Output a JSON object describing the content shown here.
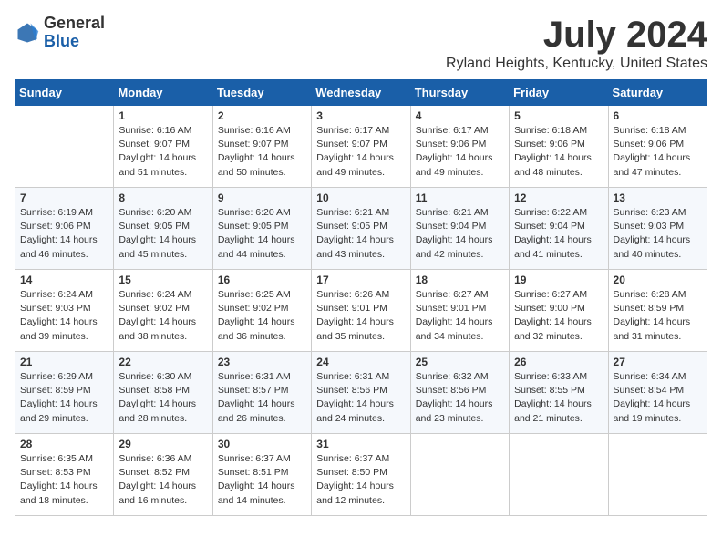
{
  "header": {
    "logo_line1": "General",
    "logo_line2": "Blue",
    "month_year": "July 2024",
    "location": "Ryland Heights, Kentucky, United States"
  },
  "weekdays": [
    "Sunday",
    "Monday",
    "Tuesday",
    "Wednesday",
    "Thursday",
    "Friday",
    "Saturday"
  ],
  "weeks": [
    [
      {
        "day": "",
        "sunrise": "",
        "sunset": "",
        "daylight": ""
      },
      {
        "day": "1",
        "sunrise": "Sunrise: 6:16 AM",
        "sunset": "Sunset: 9:07 PM",
        "daylight": "Daylight: 14 hours and 51 minutes."
      },
      {
        "day": "2",
        "sunrise": "Sunrise: 6:16 AM",
        "sunset": "Sunset: 9:07 PM",
        "daylight": "Daylight: 14 hours and 50 minutes."
      },
      {
        "day": "3",
        "sunrise": "Sunrise: 6:17 AM",
        "sunset": "Sunset: 9:07 PM",
        "daylight": "Daylight: 14 hours and 49 minutes."
      },
      {
        "day": "4",
        "sunrise": "Sunrise: 6:17 AM",
        "sunset": "Sunset: 9:06 PM",
        "daylight": "Daylight: 14 hours and 49 minutes."
      },
      {
        "day": "5",
        "sunrise": "Sunrise: 6:18 AM",
        "sunset": "Sunset: 9:06 PM",
        "daylight": "Daylight: 14 hours and 48 minutes."
      },
      {
        "day": "6",
        "sunrise": "Sunrise: 6:18 AM",
        "sunset": "Sunset: 9:06 PM",
        "daylight": "Daylight: 14 hours and 47 minutes."
      }
    ],
    [
      {
        "day": "7",
        "sunrise": "Sunrise: 6:19 AM",
        "sunset": "Sunset: 9:06 PM",
        "daylight": "Daylight: 14 hours and 46 minutes."
      },
      {
        "day": "8",
        "sunrise": "Sunrise: 6:20 AM",
        "sunset": "Sunset: 9:05 PM",
        "daylight": "Daylight: 14 hours and 45 minutes."
      },
      {
        "day": "9",
        "sunrise": "Sunrise: 6:20 AM",
        "sunset": "Sunset: 9:05 PM",
        "daylight": "Daylight: 14 hours and 44 minutes."
      },
      {
        "day": "10",
        "sunrise": "Sunrise: 6:21 AM",
        "sunset": "Sunset: 9:05 PM",
        "daylight": "Daylight: 14 hours and 43 minutes."
      },
      {
        "day": "11",
        "sunrise": "Sunrise: 6:21 AM",
        "sunset": "Sunset: 9:04 PM",
        "daylight": "Daylight: 14 hours and 42 minutes."
      },
      {
        "day": "12",
        "sunrise": "Sunrise: 6:22 AM",
        "sunset": "Sunset: 9:04 PM",
        "daylight": "Daylight: 14 hours and 41 minutes."
      },
      {
        "day": "13",
        "sunrise": "Sunrise: 6:23 AM",
        "sunset": "Sunset: 9:03 PM",
        "daylight": "Daylight: 14 hours and 40 minutes."
      }
    ],
    [
      {
        "day": "14",
        "sunrise": "Sunrise: 6:24 AM",
        "sunset": "Sunset: 9:03 PM",
        "daylight": "Daylight: 14 hours and 39 minutes."
      },
      {
        "day": "15",
        "sunrise": "Sunrise: 6:24 AM",
        "sunset": "Sunset: 9:02 PM",
        "daylight": "Daylight: 14 hours and 38 minutes."
      },
      {
        "day": "16",
        "sunrise": "Sunrise: 6:25 AM",
        "sunset": "Sunset: 9:02 PM",
        "daylight": "Daylight: 14 hours and 36 minutes."
      },
      {
        "day": "17",
        "sunrise": "Sunrise: 6:26 AM",
        "sunset": "Sunset: 9:01 PM",
        "daylight": "Daylight: 14 hours and 35 minutes."
      },
      {
        "day": "18",
        "sunrise": "Sunrise: 6:27 AM",
        "sunset": "Sunset: 9:01 PM",
        "daylight": "Daylight: 14 hours and 34 minutes."
      },
      {
        "day": "19",
        "sunrise": "Sunrise: 6:27 AM",
        "sunset": "Sunset: 9:00 PM",
        "daylight": "Daylight: 14 hours and 32 minutes."
      },
      {
        "day": "20",
        "sunrise": "Sunrise: 6:28 AM",
        "sunset": "Sunset: 8:59 PM",
        "daylight": "Daylight: 14 hours and 31 minutes."
      }
    ],
    [
      {
        "day": "21",
        "sunrise": "Sunrise: 6:29 AM",
        "sunset": "Sunset: 8:59 PM",
        "daylight": "Daylight: 14 hours and 29 minutes."
      },
      {
        "day": "22",
        "sunrise": "Sunrise: 6:30 AM",
        "sunset": "Sunset: 8:58 PM",
        "daylight": "Daylight: 14 hours and 28 minutes."
      },
      {
        "day": "23",
        "sunrise": "Sunrise: 6:31 AM",
        "sunset": "Sunset: 8:57 PM",
        "daylight": "Daylight: 14 hours and 26 minutes."
      },
      {
        "day": "24",
        "sunrise": "Sunrise: 6:31 AM",
        "sunset": "Sunset: 8:56 PM",
        "daylight": "Daylight: 14 hours and 24 minutes."
      },
      {
        "day": "25",
        "sunrise": "Sunrise: 6:32 AM",
        "sunset": "Sunset: 8:56 PM",
        "daylight": "Daylight: 14 hours and 23 minutes."
      },
      {
        "day": "26",
        "sunrise": "Sunrise: 6:33 AM",
        "sunset": "Sunset: 8:55 PM",
        "daylight": "Daylight: 14 hours and 21 minutes."
      },
      {
        "day": "27",
        "sunrise": "Sunrise: 6:34 AM",
        "sunset": "Sunset: 8:54 PM",
        "daylight": "Daylight: 14 hours and 19 minutes."
      }
    ],
    [
      {
        "day": "28",
        "sunrise": "Sunrise: 6:35 AM",
        "sunset": "Sunset: 8:53 PM",
        "daylight": "Daylight: 14 hours and 18 minutes."
      },
      {
        "day": "29",
        "sunrise": "Sunrise: 6:36 AM",
        "sunset": "Sunset: 8:52 PM",
        "daylight": "Daylight: 14 hours and 16 minutes."
      },
      {
        "day": "30",
        "sunrise": "Sunrise: 6:37 AM",
        "sunset": "Sunset: 8:51 PM",
        "daylight": "Daylight: 14 hours and 14 minutes."
      },
      {
        "day": "31",
        "sunrise": "Sunrise: 6:37 AM",
        "sunset": "Sunset: 8:50 PM",
        "daylight": "Daylight: 14 hours and 12 minutes."
      },
      {
        "day": "",
        "sunrise": "",
        "sunset": "",
        "daylight": ""
      },
      {
        "day": "",
        "sunrise": "",
        "sunset": "",
        "daylight": ""
      },
      {
        "day": "",
        "sunrise": "",
        "sunset": "",
        "daylight": ""
      }
    ]
  ]
}
